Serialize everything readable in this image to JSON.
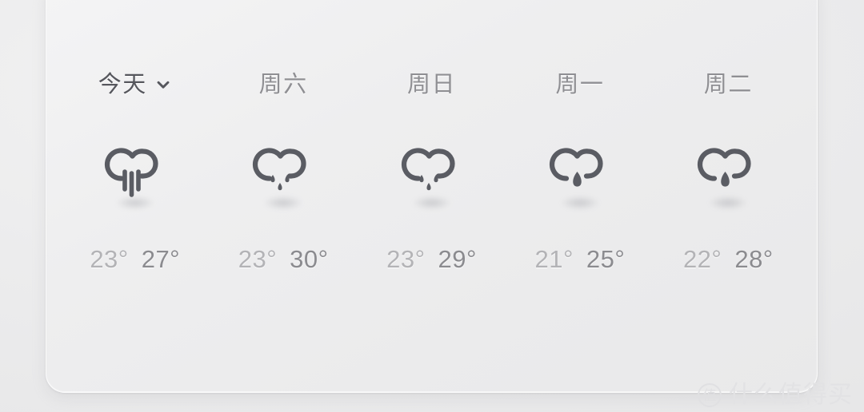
{
  "card": {
    "today_selector": {
      "label": "今天",
      "chevron_icon": "chevron-down-icon"
    },
    "days": [
      {
        "label": "今天",
        "is_today": true,
        "icon": "cloud-heavy-rain-icon",
        "icon_description": "cloud with four vertical rain streaks",
        "temp_low": "23°",
        "temp_high": "27°"
      },
      {
        "label": "周六",
        "is_today": false,
        "icon": "cloud-drizzle-icon",
        "icon_description": "cloud with three droplets",
        "temp_low": "23°",
        "temp_high": "30°"
      },
      {
        "label": "周日",
        "is_today": false,
        "icon": "cloud-drizzle-icon",
        "icon_description": "cloud with three droplets",
        "temp_low": "23°",
        "temp_high": "29°"
      },
      {
        "label": "周一",
        "is_today": false,
        "icon": "cloud-single-drop-icon",
        "icon_description": "cloud with one large droplet",
        "temp_low": "21°",
        "temp_high": "25°"
      },
      {
        "label": "周二",
        "is_today": false,
        "icon": "cloud-single-drop-icon",
        "icon_description": "cloud with one large droplet",
        "temp_low": "22°",
        "temp_high": "28°"
      }
    ]
  },
  "watermark": {
    "badge_text": "值",
    "text": "什么值得买"
  },
  "colors": {
    "today_label": "#56575d",
    "day_label": "#8f8f93",
    "temp_low": "#b3b3b6",
    "temp_high": "#8b8b8f",
    "icon_stroke": "#5a5c63",
    "card_background": "#eeeeef",
    "page_background": "#ececec",
    "watermark": "#e2e2e4"
  }
}
